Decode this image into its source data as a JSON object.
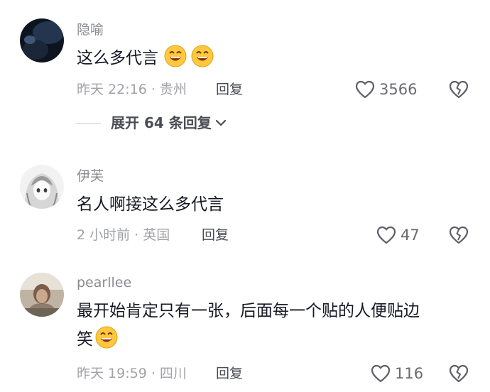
{
  "comments": [
    {
      "username": "隐喻",
      "text": "这么多代言",
      "trailing_emojis": [
        "smile-emoji",
        "smile-emoji"
      ],
      "time_location": "昨天 22:16 · 贵州",
      "reply_label": "回复",
      "like_count": "3566",
      "expand_label": "展开 64 条回复"
    },
    {
      "username": "伊芙",
      "text": "名人啊接这么多代言",
      "time_location": "2 小时前 · 英国",
      "reply_label": "回复",
      "like_count": "47"
    },
    {
      "username": "pearllee",
      "text_line1": "最开始肯定只有一张，后面每一个贴的人便贴边",
      "text_line2": "笑",
      "trailing_emojis": [
        "smile-emoji"
      ],
      "time_location": "昨天 19:59 · 四川",
      "reply_label": "回复",
      "like_count": "116"
    }
  ],
  "colors": {
    "text_primary": "#161823",
    "text_secondary": "#8a8b91",
    "text_meta": "#a1a2a7",
    "emoji_face": "#ffc83d"
  },
  "icons": {
    "like": "heart-outline-icon",
    "dislike": "broken-heart-icon",
    "expand": "chevron-down-icon"
  }
}
